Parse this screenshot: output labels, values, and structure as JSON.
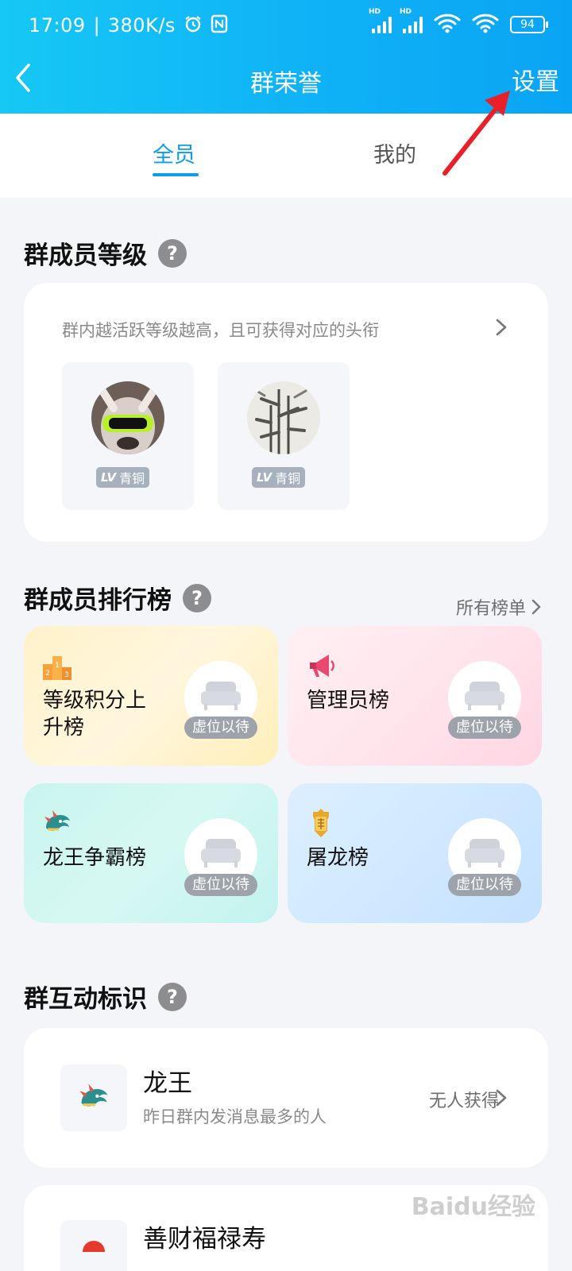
{
  "status_bar": {
    "time": "17:09",
    "speed": "380K/s",
    "battery": "94",
    "net_label_1": "HD",
    "net_label_2": "HD"
  },
  "header": {
    "title": "群荣誉",
    "settings_label": "设置"
  },
  "tabs": [
    {
      "label": "全员",
      "active": true
    },
    {
      "label": "我的",
      "active": false
    }
  ],
  "level_section": {
    "title": "群成员等级",
    "help": "?",
    "description": "群内越活跃等级越高，且可获得对应的头衔",
    "members": [
      {
        "lv": "LV",
        "rank": "青铜"
      },
      {
        "lv": "LV",
        "rank": "青铜"
      }
    ]
  },
  "ranking_section": {
    "title": "群成员排行榜",
    "help": "?",
    "all_lists": "所有榜单",
    "tiles": [
      {
        "label_line1": "等级积分上",
        "label_line2": "升榜",
        "vacant": "虚位以待",
        "icon": "podium-icon"
      },
      {
        "label_line1": "管理员榜",
        "label_line2": "",
        "vacant": "虚位以待",
        "icon": "megaphone-icon"
      },
      {
        "label_line1": "龙王争霸榜",
        "label_line2": "",
        "vacant": "虚位以待",
        "icon": "dragon-icon"
      },
      {
        "label_line1": "屠龙榜",
        "label_line2": "",
        "vacant": "虚位以待",
        "icon": "dragon-slayer-badge-icon"
      }
    ]
  },
  "badge_section": {
    "title": "群互动标识",
    "help": "?",
    "items": [
      {
        "name": "龙王",
        "desc": "昨日群内发消息最多的人",
        "status": "无人获得"
      },
      {
        "name": "善财福禄寿",
        "desc": "",
        "status": ""
      }
    ]
  },
  "watermark": "Baidu经验",
  "colors": {
    "header_start": "#16c8f5",
    "header_end": "#0aa4f4",
    "tab_active": "#0b9df0",
    "annotation_arrow": "#e8202a"
  }
}
